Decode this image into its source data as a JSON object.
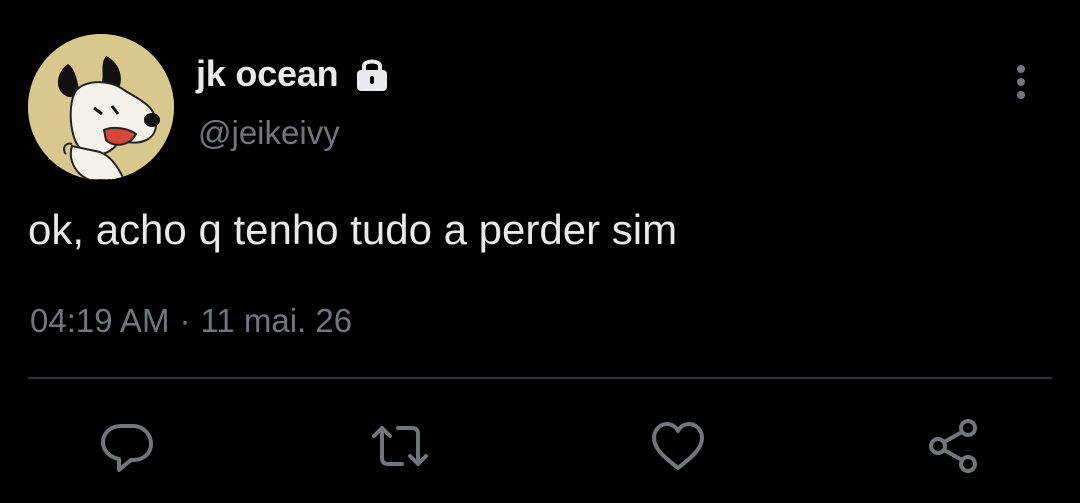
{
  "user": {
    "display_name": "jk ocean",
    "handle": "@jeikeivy",
    "avatar_icon": "snoopy-avatar",
    "protected_icon": "lock-icon"
  },
  "tweet": {
    "text": "ok, acho q tenho tudo a perder sim",
    "time": "04:19 AM",
    "separator": "·",
    "date": "11 mai. 26"
  },
  "actions": [
    {
      "icon": "reply-icon"
    },
    {
      "icon": "retweet-icon"
    },
    {
      "icon": "like-icon"
    },
    {
      "icon": "share-icon"
    }
  ],
  "colors": {
    "background": "#000000",
    "primary_text": "#e7e9ea",
    "secondary_text": "#71767b",
    "divider": "#2f3336",
    "avatar_background": "#d9c88e"
  }
}
